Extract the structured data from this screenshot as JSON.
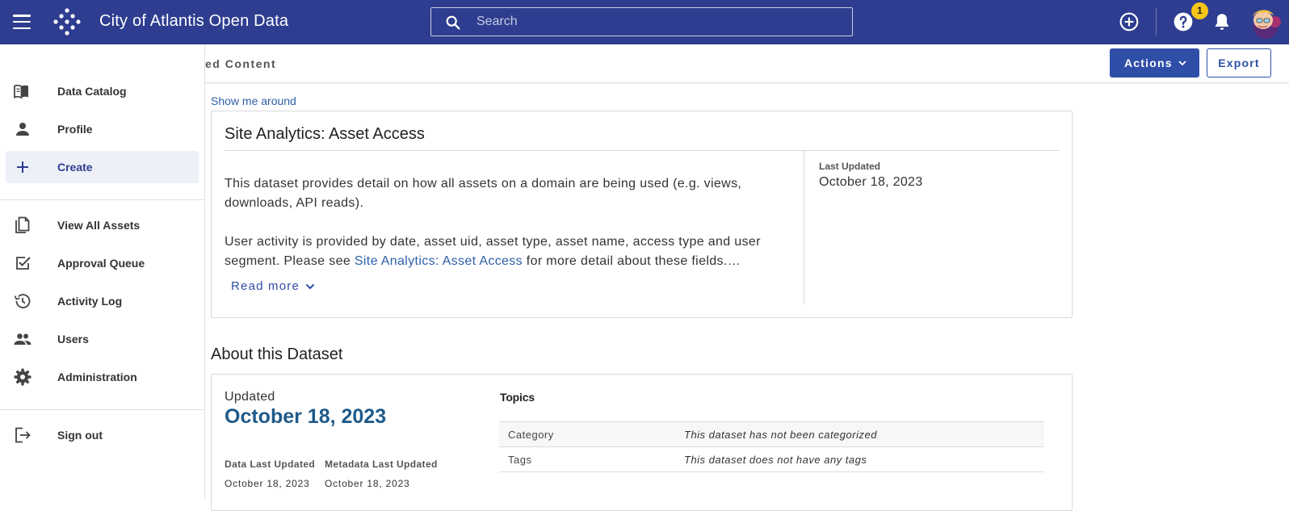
{
  "header": {
    "app_title": "City of Atlantis Open Data",
    "search_placeholder": "Search",
    "notification_count": "1",
    "icons": [
      "menu-icon",
      "logo-icon",
      "search-icon",
      "add-circle-icon",
      "help-icon",
      "bell-icon",
      "avatar"
    ]
  },
  "sidebar": {
    "items": [
      {
        "label": "Data Catalog",
        "icon": "book-icon"
      },
      {
        "label": "Profile",
        "icon": "person-icon"
      },
      {
        "label": "Create",
        "icon": "plus-icon",
        "active": true
      },
      {
        "label": "View All Assets",
        "icon": "documents-icon"
      },
      {
        "label": "Approval Queue",
        "icon": "checkbox-icon"
      },
      {
        "label": "Activity Log",
        "icon": "history-icon"
      },
      {
        "label": "Users",
        "icon": "people-icon"
      },
      {
        "label": "Administration",
        "icon": "gear-icon"
      },
      {
        "label": "Sign out",
        "icon": "sign-out-icon"
      }
    ]
  },
  "subheader": {
    "breadcrumb": "ed Content",
    "actions_label": "Actions",
    "export_label": "Export"
  },
  "main": {
    "show_me_around": "Show me around",
    "dataset_title": "Site Analytics: Asset Access",
    "description_p1": "This dataset provides detail on how all assets on a domain are being used (e.g. views, downloads, API reads).",
    "description_p2_before": "User activity is provided by date, asset uid, asset type, asset name, access type and user segment. Please see ",
    "description_p2_link": "Site Analytics: Asset Access",
    "description_p2_after": " for more detail about these fields.…",
    "read_more": "Read more",
    "last_updated_label": "Last Updated",
    "last_updated_value": "October 18, 2023"
  },
  "about": {
    "title": "About this Dataset",
    "updated_label": "Updated",
    "updated_value": "October 18, 2023",
    "data_last_updated_label": "Data Last Updated",
    "data_last_updated_value": "October 18, 2023",
    "metadata_last_updated_label": "Metadata Last Updated",
    "metadata_last_updated_value": "October 18, 2023",
    "topics_title": "Topics",
    "topics": [
      {
        "key": "Category",
        "value": "This dataset has not been categorized"
      },
      {
        "key": "Tags",
        "value": "This dataset does not have any tags"
      }
    ]
  },
  "colors": {
    "header_bg": "#2e3d8f",
    "accent": "#2e4ea8",
    "link": "#2e5fa8",
    "badge": "#f5c518",
    "date_highlight": "#1f5a8a"
  }
}
